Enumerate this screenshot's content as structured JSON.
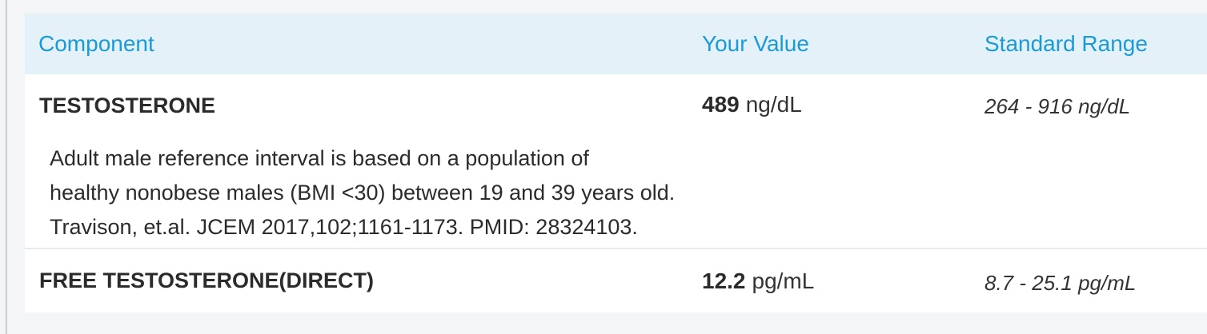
{
  "table": {
    "headers": {
      "component": "Component",
      "value": "Your Value",
      "range": "Standard Range"
    },
    "rows": [
      {
        "name": "TESTOSTERONE",
        "value": "489",
        "unit": "ng/dL",
        "range": "264 - 916 ng/dL",
        "comment": [
          "Adult male reference interval is based on a population of",
          "healthy nonobese males (BMI <30) between 19 and 39 years old.",
          "Travison, et.al. JCEM 2017,102;1161-1173. PMID: 28324103."
        ]
      },
      {
        "name": "FREE TESTOSTERONE(DIRECT)",
        "value": "12.2",
        "unit": "pg/mL",
        "range": "8.7 - 25.1 pg/mL"
      }
    ]
  },
  "colors": {
    "header_text": "#1a9bd7",
    "header_bg": "#e4f1f9",
    "page_bg": "#f3f5f7"
  }
}
